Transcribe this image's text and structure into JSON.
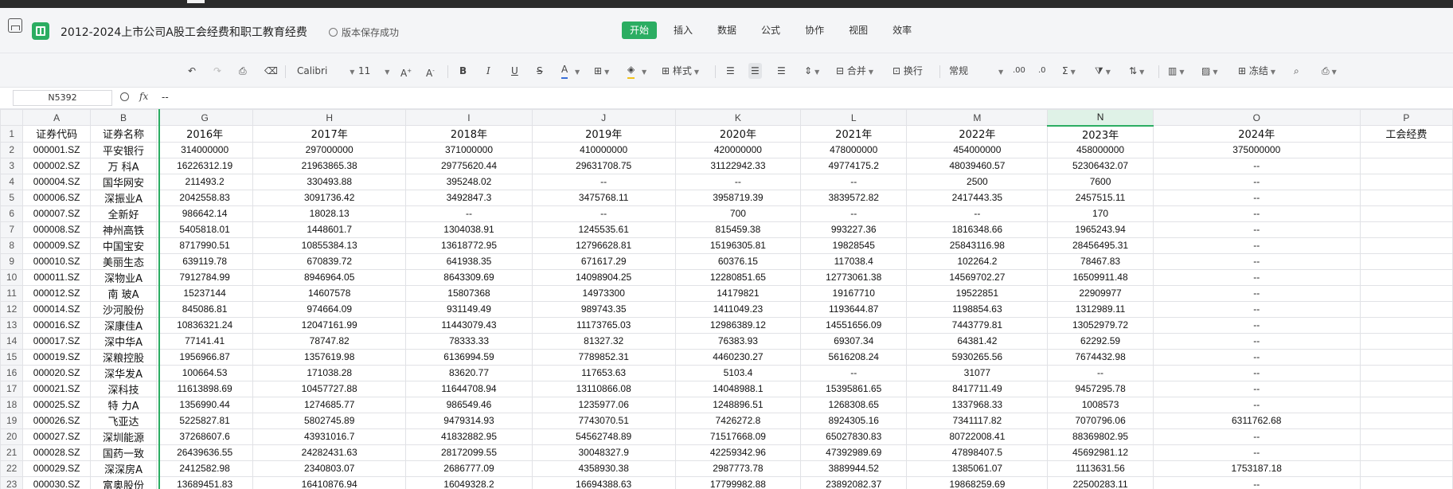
{
  "app": {
    "doc_title": "2012-2024上市公司A股工会经费和职工教育经费",
    "save_status": "版本保存成功",
    "menu": [
      {
        "label": "开始",
        "active": true
      },
      {
        "label": "插入",
        "active": false
      },
      {
        "label": "数据",
        "active": false
      },
      {
        "label": "公式",
        "active": false
      },
      {
        "label": "协作",
        "active": false
      },
      {
        "label": "视图",
        "active": false
      },
      {
        "label": "效率",
        "active": false
      }
    ]
  },
  "toolbar": {
    "font_name": "Calibri",
    "font_size": "11",
    "style_label": "样式",
    "merge_label": "合并",
    "wrap_label": "换行",
    "number_format": "常规",
    "freeze_label": "冻结",
    "sum_label": "Σ",
    "decimal_inc": ".00",
    "decimal_dec": ".0"
  },
  "formula_bar": {
    "cell_ref": "N5392",
    "fx": "fx",
    "value": "--"
  },
  "sheet": {
    "selected_column": "N",
    "columns": [
      "A",
      "B",
      "G",
      "H",
      "I",
      "J",
      "K",
      "L",
      "M",
      "N",
      "O",
      "P"
    ],
    "rows": [
      {
        "n": "1",
        "cells": [
          "证券代码",
          "证券名称",
          "2016年",
          "2017年",
          "2018年",
          "2019年",
          "2020年",
          "2021年",
          "2022年",
          "2023年",
          "2024年",
          "工会经费"
        ]
      },
      {
        "n": "2",
        "cells": [
          "000001.SZ",
          "平安银行",
          "314000000",
          "297000000",
          "371000000",
          "410000000",
          "420000000",
          "478000000",
          "454000000",
          "458000000",
          "375000000",
          ""
        ]
      },
      {
        "n": "3",
        "cells": [
          "000002.SZ",
          "万 科A",
          "16226312.19",
          "21963865.38",
          "29775620.44",
          "29631708.75",
          "31122942.33",
          "49774175.2",
          "48039460.57",
          "52306432.07",
          "--",
          ""
        ]
      },
      {
        "n": "4",
        "cells": [
          "000004.SZ",
          "国华网安",
          "211493.2",
          "330493.88",
          "395248.02",
          "--",
          "--",
          "--",
          "2500",
          "7600",
          "--",
          ""
        ]
      },
      {
        "n": "5",
        "cells": [
          "000006.SZ",
          "深振业A",
          "2042558.83",
          "3091736.42",
          "3492847.3",
          "3475768.11",
          "3958719.39",
          "3839572.82",
          "2417443.35",
          "2457515.11",
          "--",
          ""
        ]
      },
      {
        "n": "6",
        "cells": [
          "000007.SZ",
          "全新好",
          "986642.14",
          "18028.13",
          "--",
          "--",
          "700",
          "--",
          "--",
          "170",
          "--",
          ""
        ]
      },
      {
        "n": "7",
        "cells": [
          "000008.SZ",
          "神州高铁",
          "5405818.01",
          "1448601.7",
          "1304038.91",
          "1245535.61",
          "815459.38",
          "993227.36",
          "1816348.66",
          "1965243.94",
          "--",
          ""
        ]
      },
      {
        "n": "8",
        "cells": [
          "000009.SZ",
          "中国宝安",
          "8717990.51",
          "10855384.13",
          "13618772.95",
          "12796628.81",
          "15196305.81",
          "19828545",
          "25843116.98",
          "28456495.31",
          "--",
          ""
        ]
      },
      {
        "n": "9",
        "cells": [
          "000010.SZ",
          "美丽生态",
          "639119.78",
          "670839.72",
          "641938.35",
          "671617.29",
          "60376.15",
          "117038.4",
          "102264.2",
          "78467.83",
          "--",
          ""
        ]
      },
      {
        "n": "10",
        "cells": [
          "000011.SZ",
          "深物业A",
          "7912784.99",
          "8946964.05",
          "8643309.69",
          "14098904.25",
          "12280851.65",
          "12773061.38",
          "14569702.27",
          "16509911.48",
          "--",
          ""
        ]
      },
      {
        "n": "11",
        "cells": [
          "000012.SZ",
          "南 玻A",
          "15237144",
          "14607578",
          "15807368",
          "14973300",
          "14179821",
          "19167710",
          "19522851",
          "22909977",
          "--",
          ""
        ]
      },
      {
        "n": "12",
        "cells": [
          "000014.SZ",
          "沙河股份",
          "845086.81",
          "974664.09",
          "931149.49",
          "989743.35",
          "1411049.23",
          "1193644.87",
          "1198854.63",
          "1312989.11",
          "--",
          ""
        ]
      },
      {
        "n": "13",
        "cells": [
          "000016.SZ",
          "深康佳A",
          "10836321.24",
          "12047161.99",
          "11443079.43",
          "11173765.03",
          "12986389.12",
          "14551656.09",
          "7443779.81",
          "13052979.72",
          "--",
          ""
        ]
      },
      {
        "n": "14",
        "cells": [
          "000017.SZ",
          "深中华A",
          "77141.41",
          "78747.82",
          "78333.33",
          "81327.32",
          "76383.93",
          "69307.34",
          "64381.42",
          "62292.59",
          "--",
          ""
        ]
      },
      {
        "n": "15",
        "cells": [
          "000019.SZ",
          "深粮控股",
          "1956966.87",
          "1357619.98",
          "6136994.59",
          "7789852.31",
          "4460230.27",
          "5616208.24",
          "5930265.56",
          "7674432.98",
          "--",
          ""
        ]
      },
      {
        "n": "16",
        "cells": [
          "000020.SZ",
          "深华发A",
          "100664.53",
          "171038.28",
          "83620.77",
          "117653.63",
          "5103.4",
          "--",
          "31077",
          "--",
          "--",
          ""
        ]
      },
      {
        "n": "17",
        "cells": [
          "000021.SZ",
          "深科技",
          "11613898.69",
          "10457727.88",
          "11644708.94",
          "13110866.08",
          "14048988.1",
          "15395861.65",
          "8417711.49",
          "9457295.78",
          "--",
          ""
        ]
      },
      {
        "n": "18",
        "cells": [
          "000025.SZ",
          "特 力A",
          "1356990.44",
          "1274685.77",
          "986549.46",
          "1235977.06",
          "1248896.51",
          "1268308.65",
          "1337968.33",
          "1008573",
          "--",
          ""
        ]
      },
      {
        "n": "19",
        "cells": [
          "000026.SZ",
          "飞亚达",
          "5225827.81",
          "5802745.89",
          "9479314.93",
          "7743070.51",
          "7426272.8",
          "8924305.16",
          "7341117.82",
          "7070796.06",
          "6311762.68",
          ""
        ]
      },
      {
        "n": "20",
        "cells": [
          "000027.SZ",
          "深圳能源",
          "37268607.6",
          "43931016.7",
          "41832882.95",
          "54562748.89",
          "71517668.09",
          "65027830.83",
          "80722008.41",
          "88369802.95",
          "--",
          ""
        ]
      },
      {
        "n": "21",
        "cells": [
          "000028.SZ",
          "国药一致",
          "26439636.55",
          "24282431.63",
          "28172099.55",
          "30048327.9",
          "42259342.96",
          "47392989.69",
          "47898407.5",
          "45692981.12",
          "--",
          ""
        ]
      },
      {
        "n": "22",
        "cells": [
          "000029.SZ",
          "深深房A",
          "2412582.98",
          "2340803.07",
          "2686777.09",
          "4358930.38",
          "2987773.78",
          "3889944.52",
          "1385061.07",
          "1113631.56",
          "1753187.18",
          ""
        ]
      },
      {
        "n": "23",
        "cells": [
          "000030.SZ",
          "富奥股份",
          "13689451.83",
          "16410876.94",
          "16049328.2",
          "16694388.63",
          "17799982.88",
          "23892082.37",
          "19868259.69",
          "22500283.11",
          "--",
          ""
        ]
      }
    ]
  }
}
